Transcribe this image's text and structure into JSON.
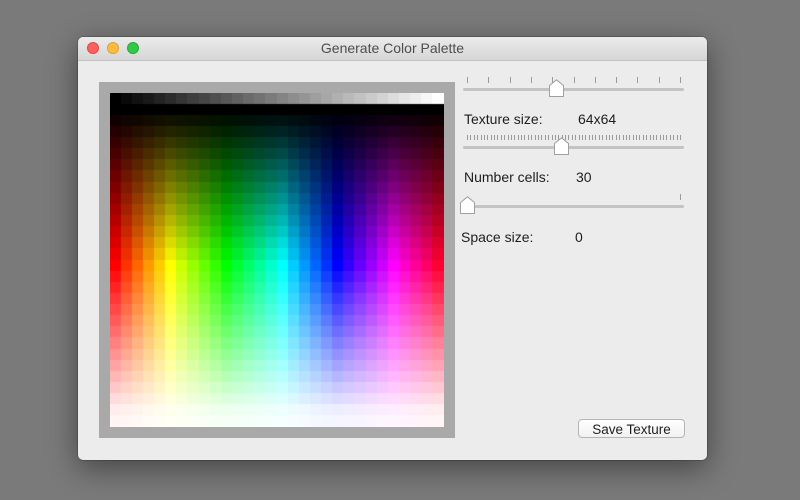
{
  "window": {
    "title": "Generate Color Palette"
  },
  "controls": {
    "texture_size": {
      "label": "Texture size:",
      "value": "64x64",
      "slider_fraction": 0.42,
      "tick_count": 11
    },
    "number_cells": {
      "label": "Number cells:",
      "value": "30",
      "slider_fraction": 0.44,
      "tick_count": 64
    },
    "space_size": {
      "label": "Space size:",
      "value": "0",
      "slider_fraction": 0.0,
      "tick_count": 2
    }
  },
  "buttons": {
    "save_label": "Save Texture"
  },
  "colors": {
    "close": "#fc605c",
    "minimize": "#fdbc40",
    "zoom": "#34c84a",
    "palette_frame": "#a9a9a9"
  }
}
